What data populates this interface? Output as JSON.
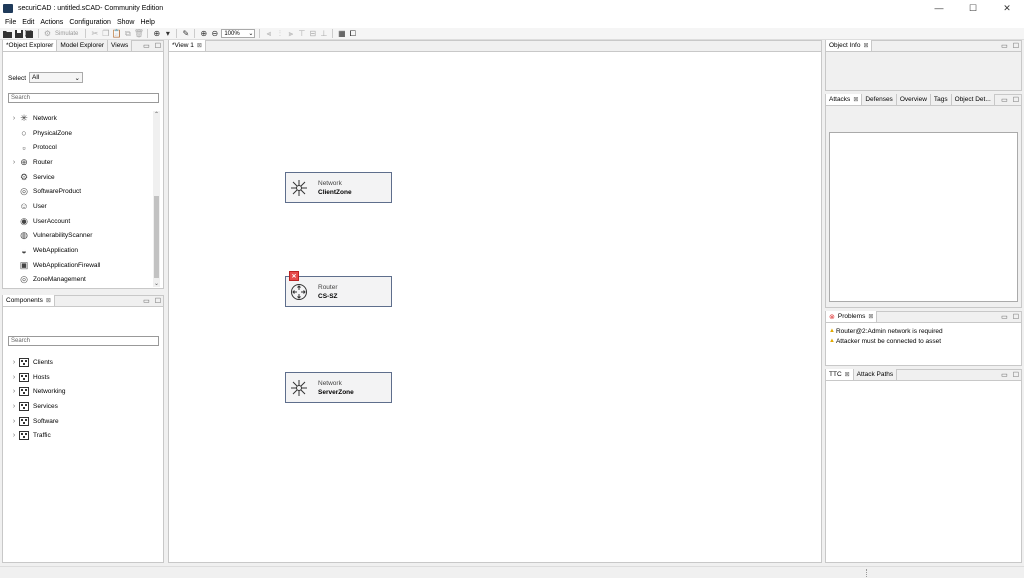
{
  "window": {
    "title": "securiCAD : untitled.sCAD- Community Edition",
    "controls": [
      "—",
      "☐",
      "✕"
    ]
  },
  "menu": [
    "File",
    "Edit",
    "Actions",
    "Configuration",
    "Show",
    "Help"
  ],
  "toolbar": {
    "simulate_label": "Simulate",
    "zoom_value": "100%"
  },
  "object_explorer": {
    "tabs": [
      "*Object Explorer",
      "Model Explorer",
      "Views"
    ],
    "select_label": "Select",
    "select_value": "All",
    "search_placeholder": "Search",
    "items": [
      {
        "label": "Network",
        "icon": "network-icon",
        "expandable": true
      },
      {
        "label": "PhysicalZone",
        "icon": "physical-zone-icon",
        "expandable": false
      },
      {
        "label": "Protocol",
        "icon": "protocol-icon",
        "expandable": false
      },
      {
        "label": "Router",
        "icon": "router-icon",
        "expandable": true
      },
      {
        "label": "Service",
        "icon": "service-icon",
        "expandable": false
      },
      {
        "label": "SoftwareProduct",
        "icon": "software-product-icon",
        "expandable": false
      },
      {
        "label": "User",
        "icon": "user-icon",
        "expandable": false
      },
      {
        "label": "UserAccount",
        "icon": "user-account-icon",
        "expandable": false
      },
      {
        "label": "VulnerabilityScanner",
        "icon": "vulnerability-scanner-icon",
        "expandable": false
      },
      {
        "label": "WebApplication",
        "icon": "web-application-icon",
        "expandable": false
      },
      {
        "label": "WebApplicationFirewall",
        "icon": "web-application-firewall-icon",
        "expandable": false
      },
      {
        "label": "ZoneManagement",
        "icon": "zone-management-icon",
        "expandable": false
      }
    ]
  },
  "components": {
    "tab": "Components",
    "search_placeholder": "Search",
    "items": [
      "Clients",
      "Hosts",
      "Networking",
      "Services",
      "Software",
      "Traffic"
    ]
  },
  "editor": {
    "tab": "*View 1",
    "nodes": [
      {
        "type": "Network",
        "name": "ClientZone",
        "icon": "network-icon",
        "error": false
      },
      {
        "type": "Router",
        "name": "CS-SZ",
        "icon": "router-icon",
        "error": true
      },
      {
        "type": "Network",
        "name": "ServerZone",
        "icon": "network-icon",
        "error": false
      }
    ]
  },
  "object_info": {
    "tab": "Object Info"
  },
  "attacks_panel": {
    "tabs": [
      "Attacks",
      "Defenses",
      "Overview",
      "Tags",
      "Object Det..."
    ]
  },
  "problems": {
    "tab": "Problems",
    "items": [
      "Router@2:Admin network is required",
      "Attacker must be connected to asset"
    ]
  },
  "ttc_panel": {
    "tabs": [
      "TTC",
      "Attack Paths"
    ]
  }
}
